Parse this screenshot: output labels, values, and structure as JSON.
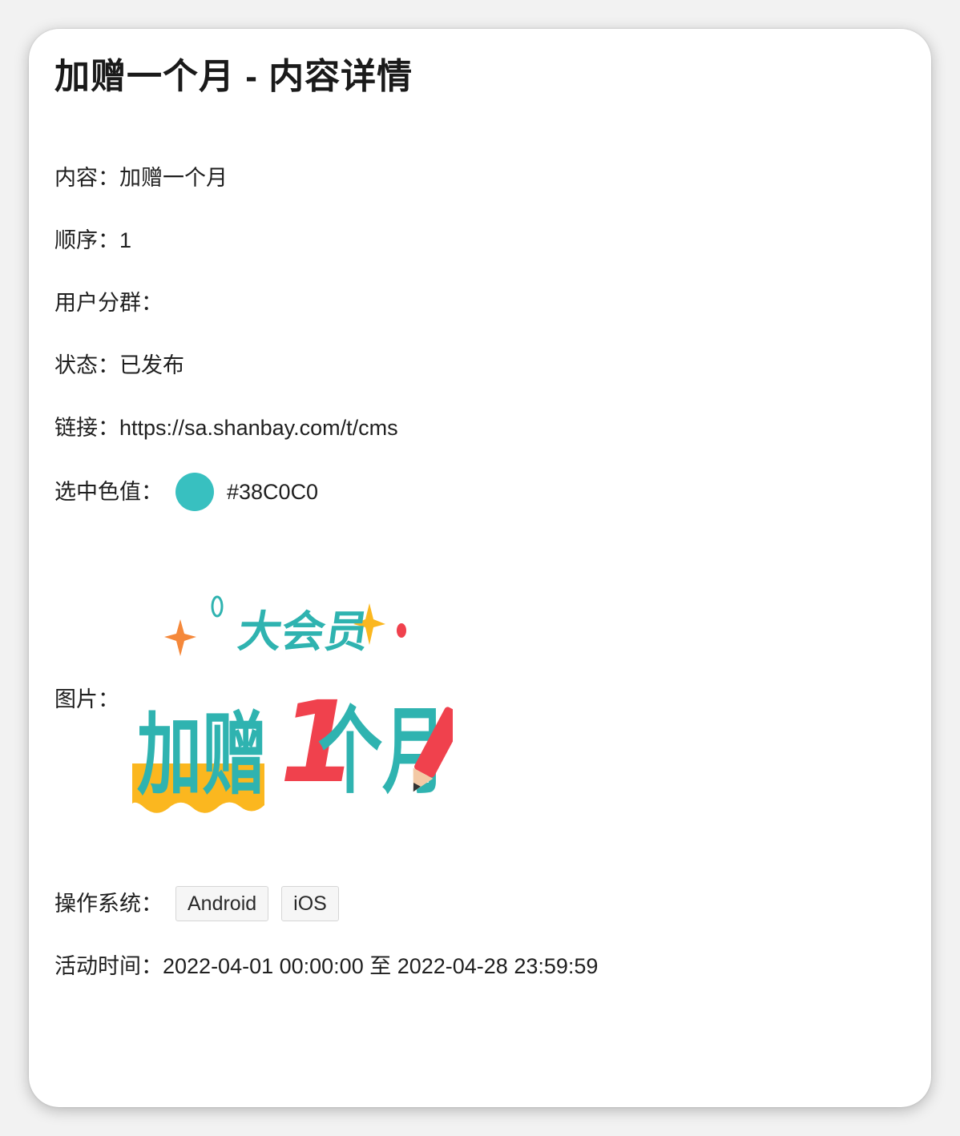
{
  "page": {
    "title": "加赠一个月 - 内容详情"
  },
  "fields": {
    "content_label": "内容：",
    "content_value": "加赠一个月",
    "order_label": "顺序：",
    "order_value": "1",
    "segment_label": "用户分群：",
    "segment_value": "",
    "status_label": "状态：",
    "status_value": "已发布",
    "link_label": "链接：",
    "link_value": "https://sa.shanbay.com/t/cms",
    "color_label": "选中色值：",
    "color_value": "#38C0C0",
    "color_hex": "#38C0C0",
    "image_label": "图片：",
    "os_label": "操作系统：",
    "os_tags": [
      "Android",
      "iOS"
    ],
    "time_label": "活动时间：",
    "time_value": "2022-04-01 00:00:00 至 2022-04-28 23:59:59"
  },
  "banner": {
    "top_text": "大会员",
    "main_text_1": "加赠",
    "main_number": "1",
    "main_text_2": "个月",
    "colors": {
      "teal": "#2fb3b0",
      "red": "#f0414d",
      "yellow": "#fbb71f",
      "orange": "#f5883a"
    }
  }
}
